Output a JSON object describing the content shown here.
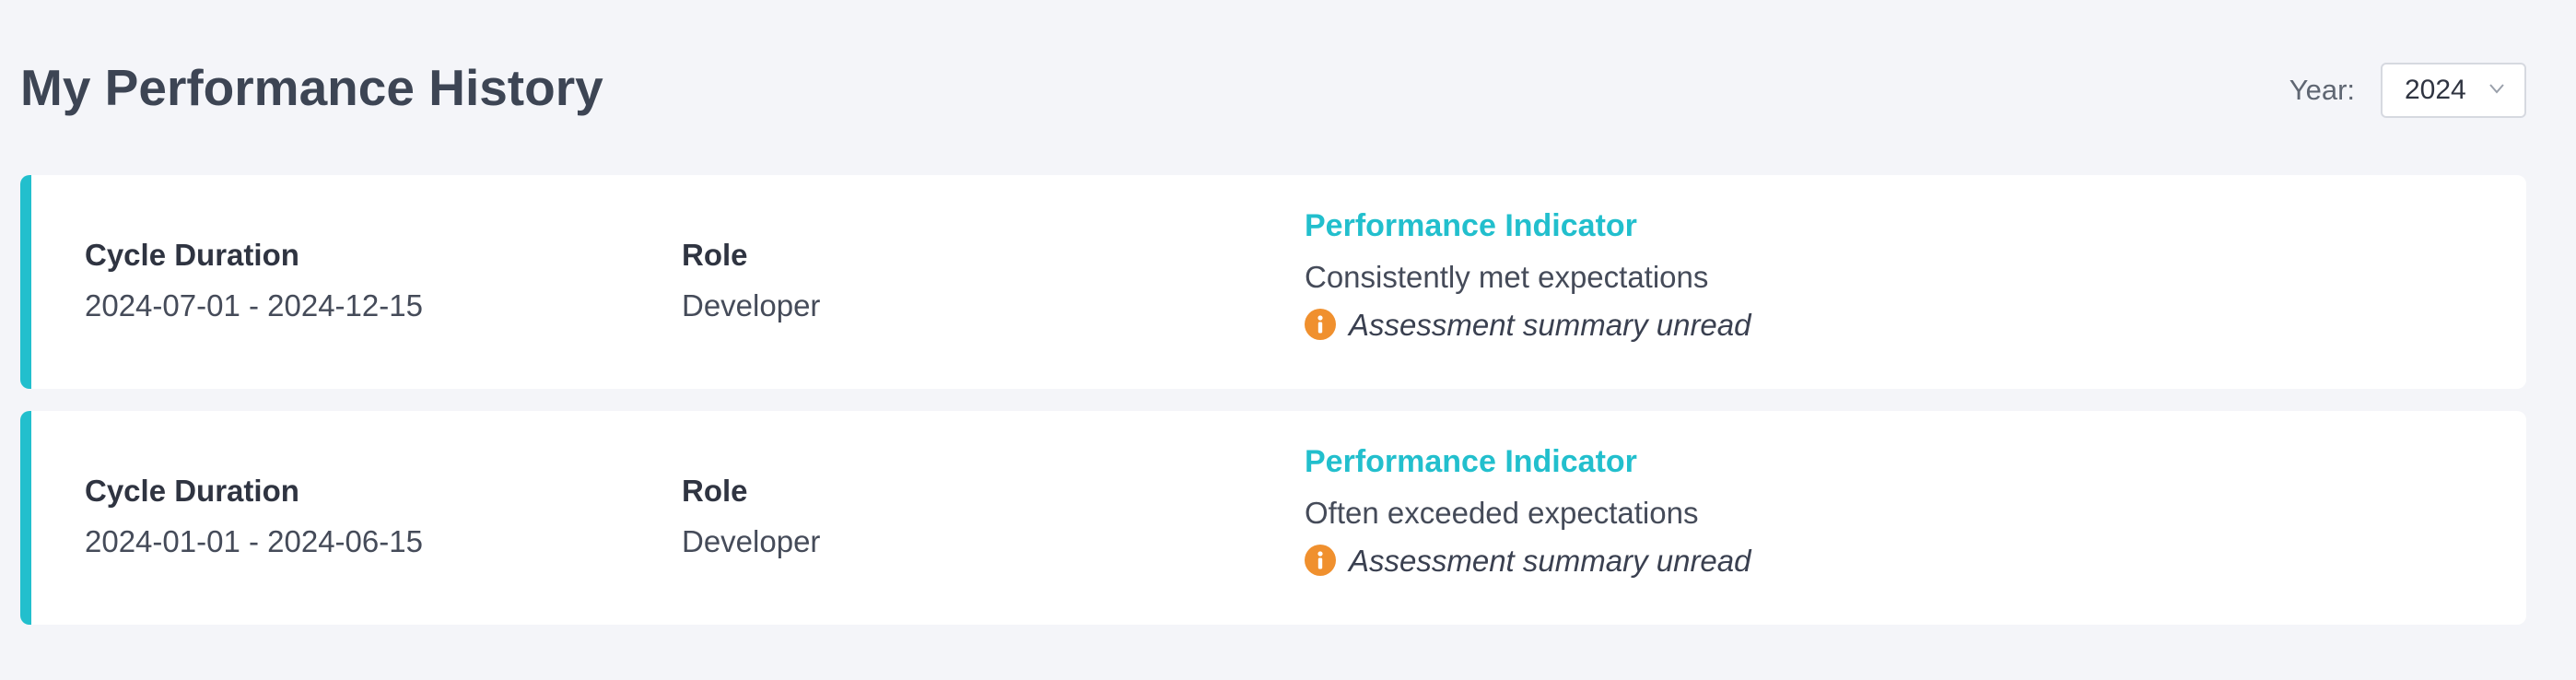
{
  "page": {
    "title": "My Performance History"
  },
  "year_filter": {
    "label": "Year:",
    "selected": "2024"
  },
  "colors": {
    "accent": "#22bfcd",
    "warning": "#f0902e",
    "background": "#f4f5f9"
  },
  "records": [
    {
      "cycle_label": "Cycle Duration",
      "cycle_value": "2024-07-01 - 2024-12-15",
      "role_label": "Role",
      "role_value": "Developer",
      "perf_title": "Performance Indicator",
      "perf_value": "Consistently met expectations",
      "notice_icon": "info-icon",
      "notice_text": "Assessment summary unread"
    },
    {
      "cycle_label": "Cycle Duration",
      "cycle_value": "2024-01-01 - 2024-06-15",
      "role_label": "Role",
      "role_value": "Developer",
      "perf_title": "Performance Indicator",
      "perf_value": "Often exceeded expectations",
      "notice_icon": "info-icon",
      "notice_text": "Assessment summary unread"
    }
  ]
}
